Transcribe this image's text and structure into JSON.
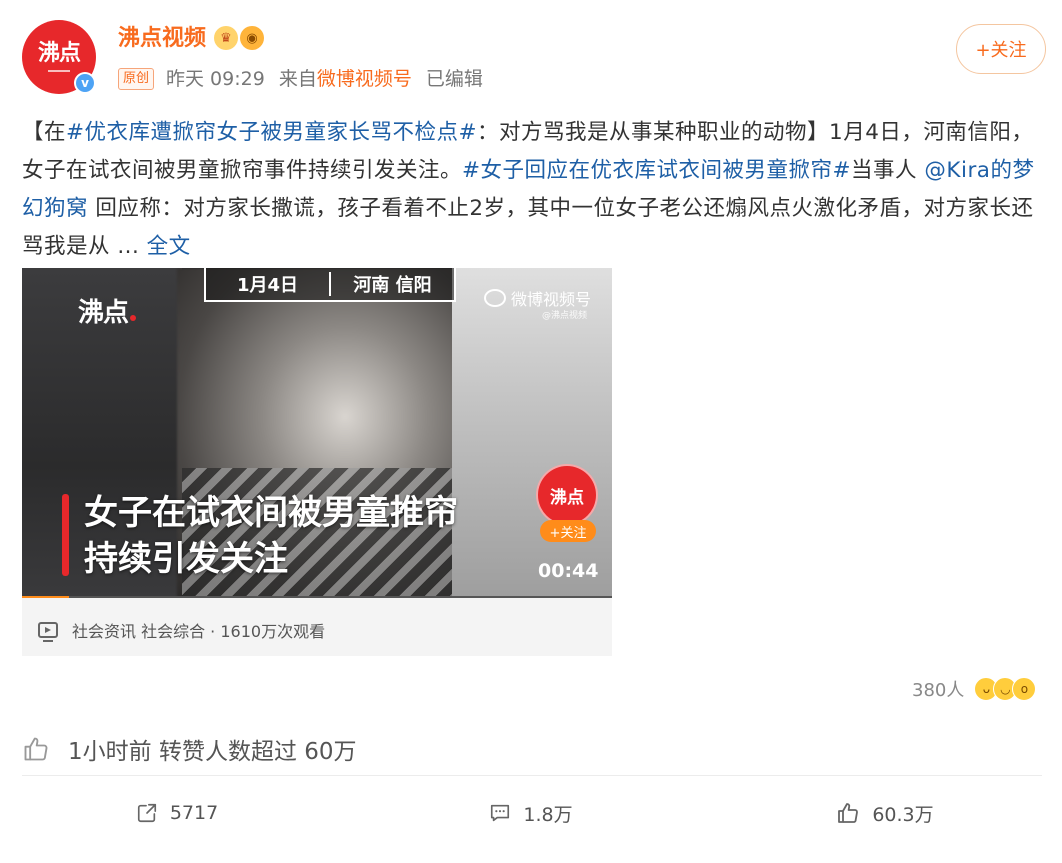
{
  "header": {
    "avatar_text": "沸点",
    "verified_mark": "v",
    "name": "沸点视频",
    "badges": [
      "crown-badge-icon",
      "fish-badge-icon"
    ],
    "tag": "原创",
    "time": "昨天 09:29",
    "source_prefix": "来自",
    "source": "微博视频号",
    "edited": "已编辑",
    "follow_label": "+关注"
  },
  "post": {
    "p1": "【在",
    "hashtag1": "#优衣库遭掀帘女子被男童家长骂不检点#",
    "p2": "：对方骂我是从事某种职业的动物】1月4日，河南信阳，女子在试衣间被男童掀帘事件持续引发关注。",
    "hashtag2": "#女子回应在优衣库试衣间被男童掀帘#",
    "p3": "当事人 ",
    "mention": "@Kira的梦幻狗窝",
    "p4": " 回应称：对方家长撒谎，孩子看着不止2岁，其中一位女子老公还煽风点火激化矛盾，对方家长还骂我是从 ... ",
    "more_label": "全文"
  },
  "video": {
    "date": "1月4日",
    "place": "河南 信阳",
    "logo": "沸点",
    "platform": "微博视频号",
    "platform_sub": "@沸点视频",
    "caption_line1": "女子在试衣间被男童推帘",
    "caption_line2": "持续引发关注",
    "avatar_text": "沸点",
    "follow_label": "+关注",
    "duration": "00:44",
    "progress": 0.08,
    "meta": "社会资讯 社会综合 · 1610万次观看"
  },
  "reactions": {
    "count": "380人",
    "emojis": [
      "laugh-emoji-icon",
      "grin-emoji-icon",
      "wow-emoji-icon"
    ]
  },
  "notice": {
    "text": "1小时前 转赞人数超过 60万"
  },
  "actions": {
    "share_count": "5717",
    "comment_count": "1.8万",
    "like_count": "60.3万"
  },
  "colors": {
    "brand": "#f86b1e",
    "link": "#1e5fa6",
    "avatar_red": "#e7282b"
  }
}
